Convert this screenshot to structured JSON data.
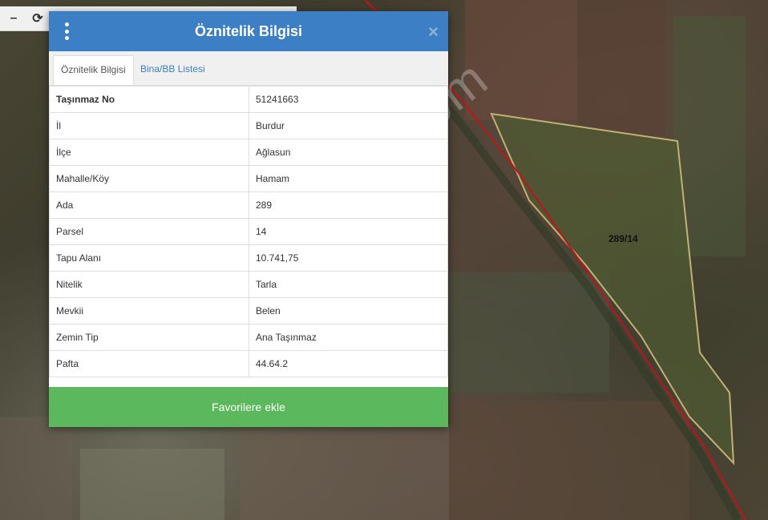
{
  "map": {
    "parcel_label": "289/14",
    "watermark": "emlakjet.com",
    "controls": {
      "zoom_out_icon": "minus-icon",
      "refresh_icon": "refresh-icon"
    }
  },
  "dialog": {
    "title": "Öznitelik Bilgisi",
    "tabs": [
      {
        "label": "Öznitelik Bilgisi",
        "active": true
      },
      {
        "label": "Bina/BB Listesi",
        "active": false
      }
    ],
    "rows": [
      {
        "key": "Taşınmaz No",
        "value": "51241663"
      },
      {
        "key": "İl",
        "value": "Burdur"
      },
      {
        "key": "İlçe",
        "value": "Ağlasun"
      },
      {
        "key": "Mahalle/Köy",
        "value": "Hamam"
      },
      {
        "key": "Ada",
        "value": "289"
      },
      {
        "key": "Parsel",
        "value": "14"
      },
      {
        "key": "Tapu Alanı",
        "value": "10.741,75"
      },
      {
        "key": "Nitelik",
        "value": "Tarla"
      },
      {
        "key": "Mevkii",
        "value": "Belen"
      },
      {
        "key": "Zemin Tip",
        "value": "Ana Taşınmaz"
      },
      {
        "key": "Pafta",
        "value": "44.64.2"
      }
    ],
    "favorite_button": "Favorilere ekle"
  },
  "colors": {
    "header": "#3c7fc4",
    "button": "#5cb85c",
    "boundary": "#c2b074",
    "road_line": "#c0141a"
  }
}
